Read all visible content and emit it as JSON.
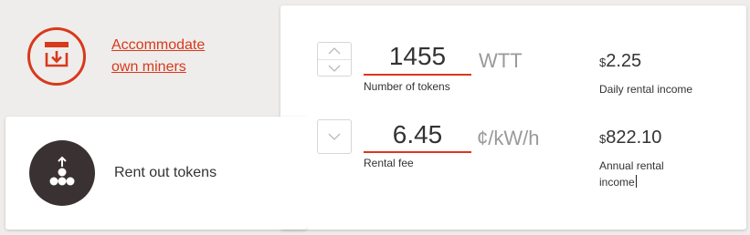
{
  "options": {
    "accommodate": {
      "label_line1": "Accommodate",
      "label_line2": "own miners",
      "icon": "download-tray-icon"
    },
    "rent_out": {
      "label": "Rent out tokens",
      "icon": "upload-coins-icon"
    }
  },
  "calculator": {
    "tokens": {
      "value": "1455",
      "unit": "WTT",
      "label": "Number of tokens"
    },
    "fee": {
      "value": "6.45",
      "unit": "¢/kW/h",
      "label": "Rental fee"
    }
  },
  "results": {
    "daily": {
      "currency": "$",
      "amount": "2.25",
      "label": "Daily rental income"
    },
    "annual": {
      "currency": "$",
      "amount": "822.10",
      "label_line1": "Annual rental",
      "label_line2": "income"
    }
  },
  "colors": {
    "accent": "#d8391c",
    "dark_circle": "#3a3232",
    "background": "#efedeb"
  }
}
